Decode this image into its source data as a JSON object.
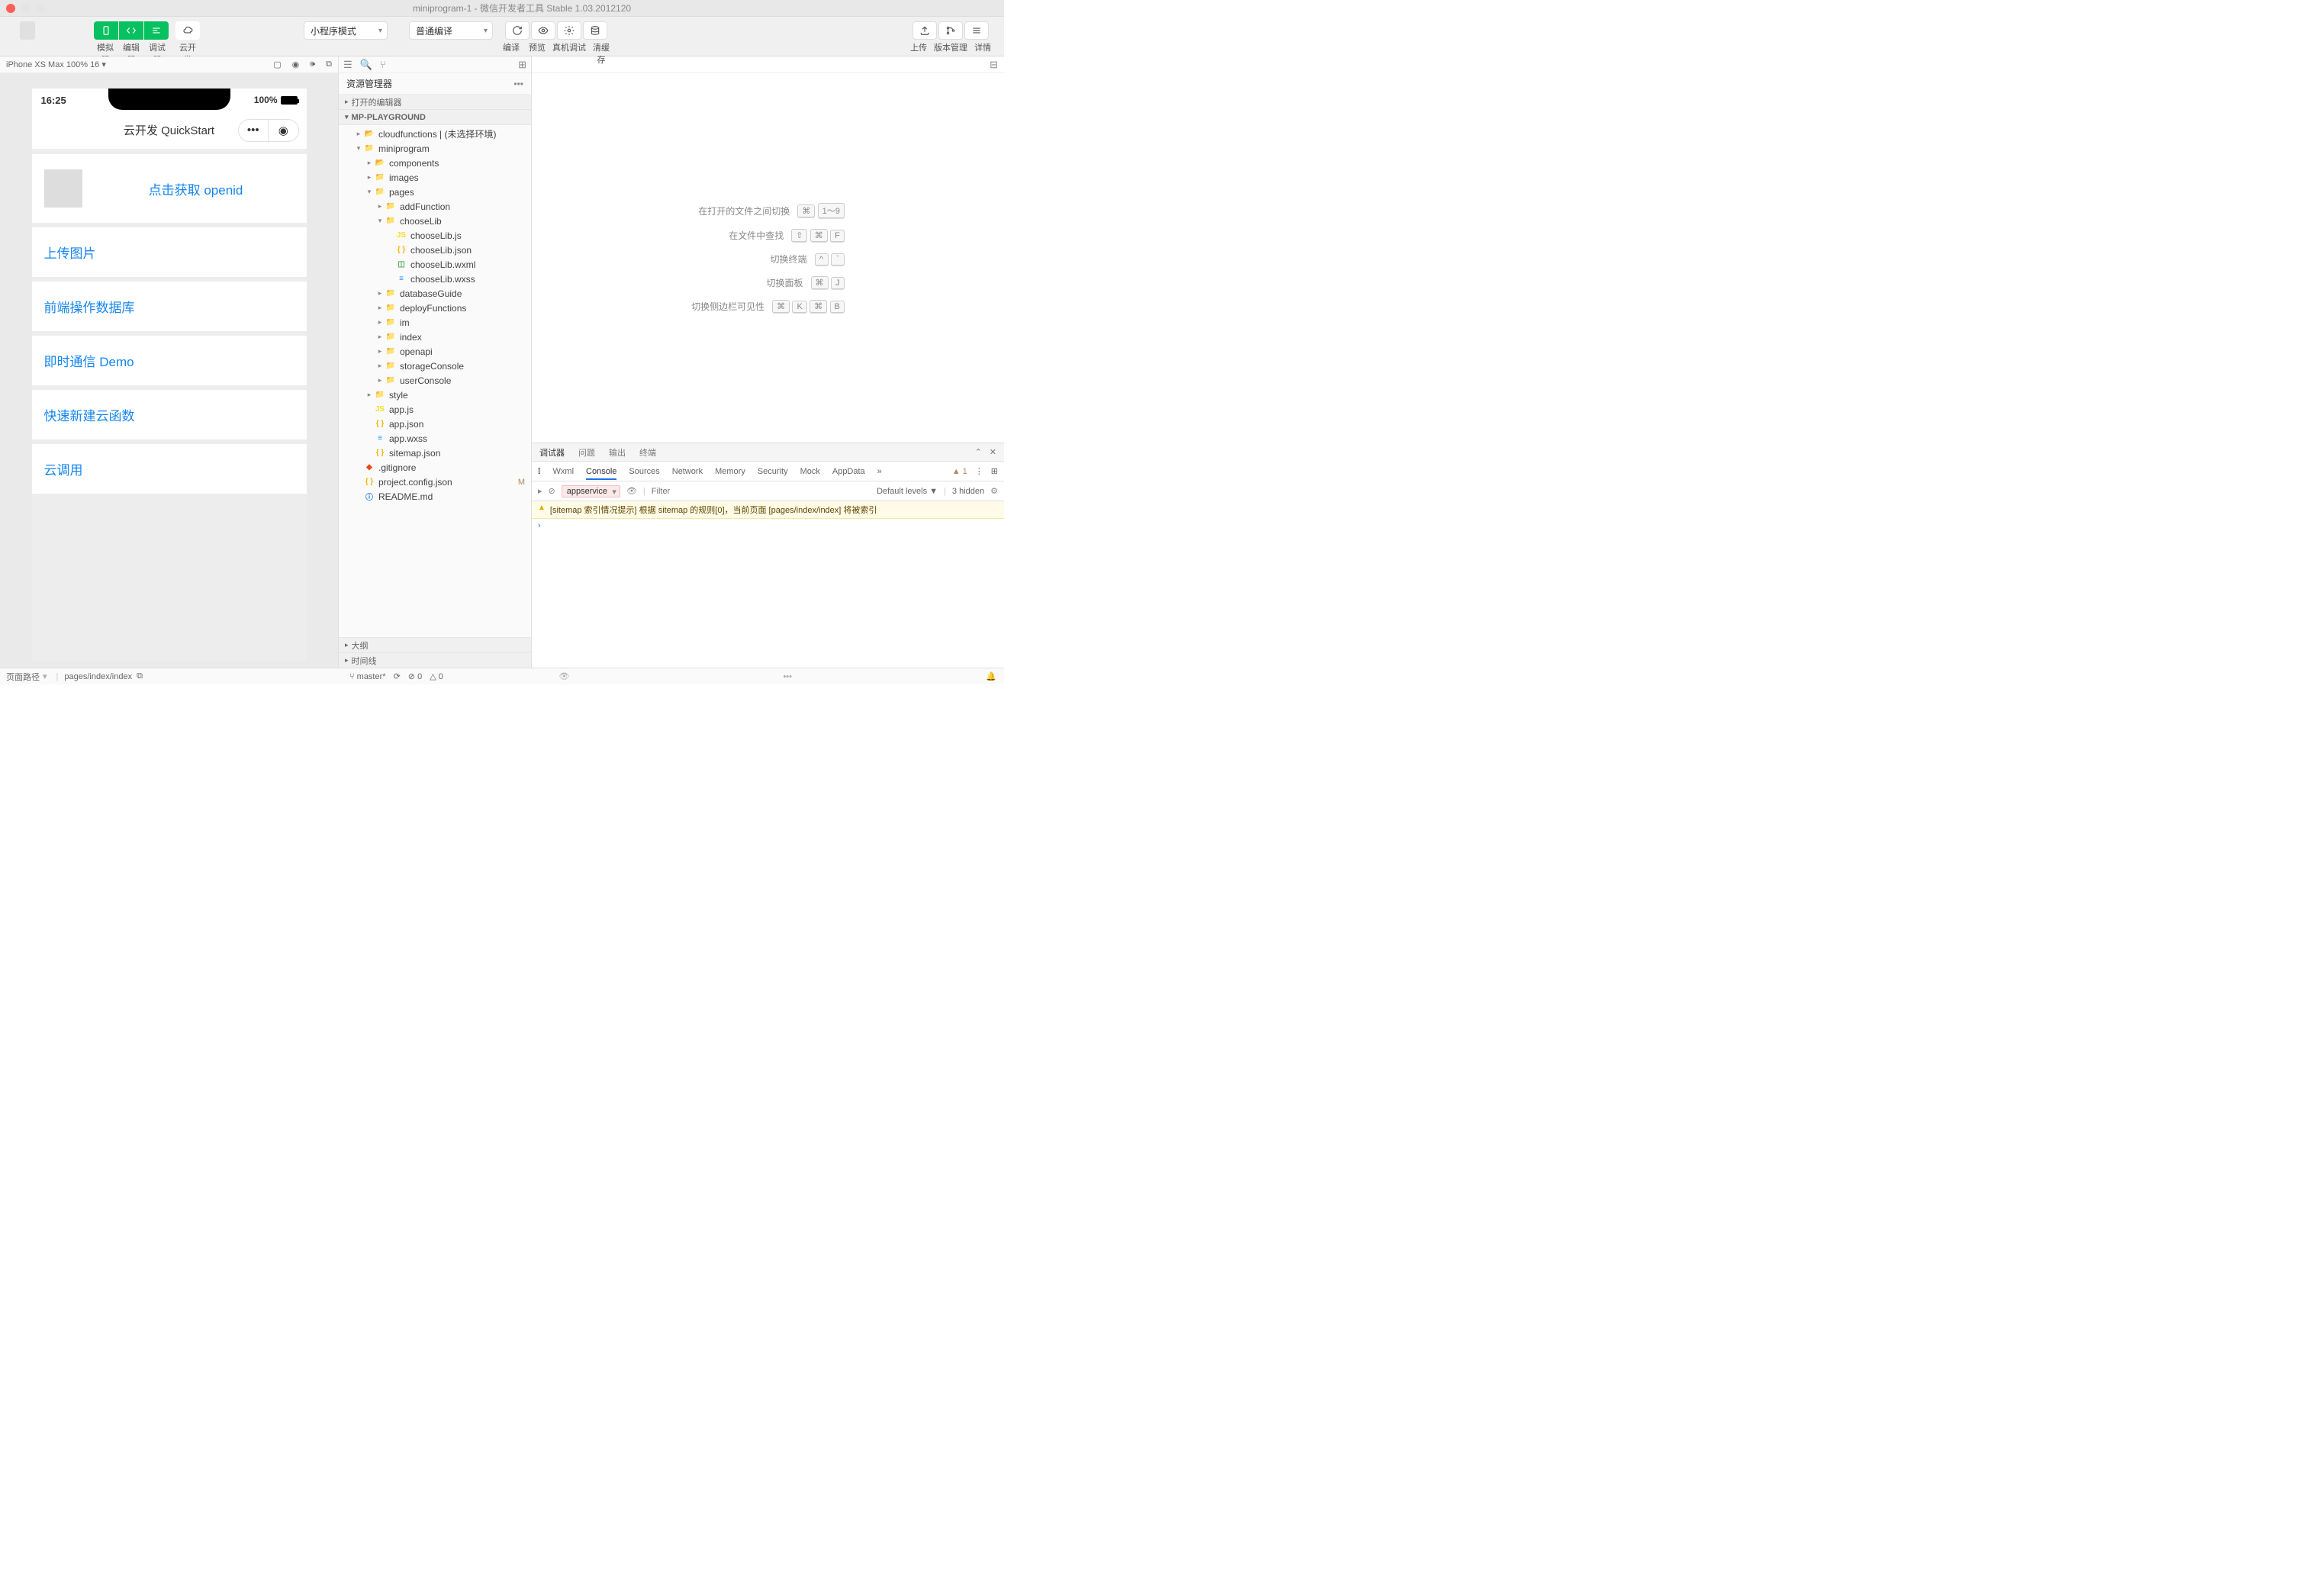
{
  "window": {
    "title": "miniprogram-1  - 微信开发者工具 Stable 1.03.2012120"
  },
  "toolbar": {
    "simulator": "模拟器",
    "editor": "编辑器",
    "debugger": "调试器",
    "cloud": "云开发",
    "mode": "小程序模式",
    "compile": "普通编译",
    "compileBtn": "编译",
    "preview": "预览",
    "realDebug": "真机调试",
    "clearCache": "清缓存",
    "upload": "上传",
    "version": "版本管理",
    "details": "详情"
  },
  "simBar": {
    "device": "iPhone XS Max 100% 16"
  },
  "phone": {
    "time": "16:25",
    "battery": "100%",
    "title": "云开发 QuickStart",
    "cards": {
      "openid": "点击获取 openid",
      "upload": "上传图片",
      "db": "前端操作数据库",
      "im": "即时通信 Demo",
      "newfunc": "快速新建云函数",
      "cloudcall": "云调用"
    }
  },
  "explorer": {
    "title": "资源管理器",
    "openEditors": "打开的编辑器",
    "root": "MP-PLAYGROUND",
    "outline": "大纲",
    "timeline": "时间线"
  },
  "tree": [
    {
      "d": 1,
      "t": "folder-y",
      "n": "cloudfunctions | (未选择环境)",
      "arrow": "▸"
    },
    {
      "d": 1,
      "t": "folder-g",
      "n": "miniprogram",
      "arrow": "▾"
    },
    {
      "d": 2,
      "t": "folder-y",
      "n": "components",
      "arrow": "▸"
    },
    {
      "d": 2,
      "t": "folder-t",
      "n": "images",
      "arrow": "▸"
    },
    {
      "d": 2,
      "t": "folder-o",
      "n": "pages",
      "arrow": "▾"
    },
    {
      "d": 3,
      "t": "folder",
      "n": "addFunction",
      "arrow": "▸"
    },
    {
      "d": 3,
      "t": "folder",
      "n": "chooseLib",
      "arrow": "▾"
    },
    {
      "d": 4,
      "t": "js",
      "n": "chooseLib.js"
    },
    {
      "d": 4,
      "t": "json",
      "n": "chooseLib.json"
    },
    {
      "d": 4,
      "t": "wxml",
      "n": "chooseLib.wxml"
    },
    {
      "d": 4,
      "t": "wxss",
      "n": "chooseLib.wxss"
    },
    {
      "d": 3,
      "t": "folder",
      "n": "databaseGuide",
      "arrow": "▸"
    },
    {
      "d": 3,
      "t": "folder",
      "n": "deployFunctions",
      "arrow": "▸"
    },
    {
      "d": 3,
      "t": "folder",
      "n": "im",
      "arrow": "▸"
    },
    {
      "d": 3,
      "t": "folder",
      "n": "index",
      "arrow": "▸"
    },
    {
      "d": 3,
      "t": "folder",
      "n": "openapi",
      "arrow": "▸"
    },
    {
      "d": 3,
      "t": "folder",
      "n": "storageConsole",
      "arrow": "▸"
    },
    {
      "d": 3,
      "t": "folder",
      "n": "userConsole",
      "arrow": "▸"
    },
    {
      "d": 2,
      "t": "folder-b",
      "n": "style",
      "arrow": "▸"
    },
    {
      "d": 2,
      "t": "js",
      "n": "app.js"
    },
    {
      "d": 2,
      "t": "json",
      "n": "app.json"
    },
    {
      "d": 2,
      "t": "wxss",
      "n": "app.wxss"
    },
    {
      "d": 2,
      "t": "json",
      "n": "sitemap.json"
    },
    {
      "d": 1,
      "t": "git",
      "n": ".gitignore"
    },
    {
      "d": 1,
      "t": "json",
      "n": "project.config.json",
      "m": true
    },
    {
      "d": 1,
      "t": "readme",
      "n": "README.md"
    }
  ],
  "shortcuts": [
    {
      "label": "在打开的文件之间切换",
      "keys": [
        "⌘",
        "1～9"
      ]
    },
    {
      "label": "在文件中查找",
      "keys": [
        "⇧",
        "⌘",
        "F"
      ]
    },
    {
      "label": "切换终端",
      "keys": [
        "^",
        "`"
      ]
    },
    {
      "label": "切换面板",
      "keys": [
        "⌘",
        "J"
      ]
    },
    {
      "label": "切换侧边栏可见性",
      "keys": [
        "⌘",
        "K",
        "⌘",
        "B"
      ]
    }
  ],
  "debugger": {
    "tabs": {
      "debugger": "调试器",
      "problems": "问题",
      "output": "输出",
      "terminal": "终端"
    },
    "devtabs": [
      "Wxml",
      "Console",
      "Sources",
      "Network",
      "Memory",
      "Security",
      "Mock",
      "AppData"
    ],
    "warnCount": "1",
    "context": "appservice",
    "filterPlaceholder": "Filter",
    "levels": "Default levels ▼",
    "hidden": "3 hidden",
    "log": "[sitemap 索引情况提示] 根据 sitemap 的规则[0]，当前页面 [pages/index/index] 将被索引"
  },
  "status": {
    "pathLabel": "页面路径",
    "path": "pages/index/index",
    "branch": "master*",
    "errors": "0",
    "warnings": "0"
  }
}
